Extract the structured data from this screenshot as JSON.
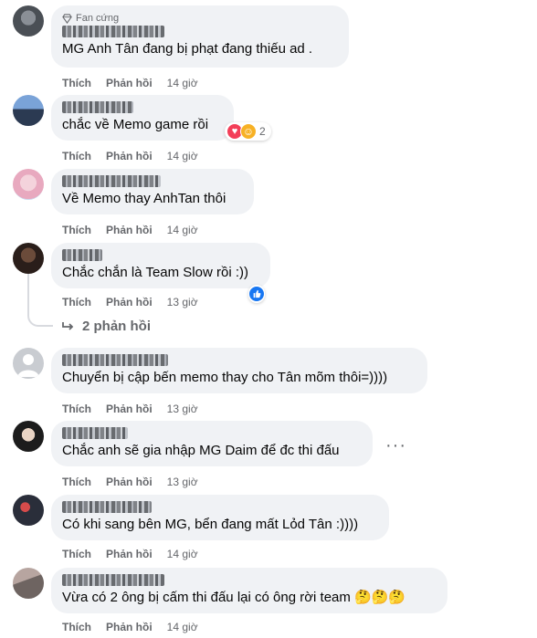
{
  "colors": {
    "bubble": "#f0f2f5",
    "secondary_text": "#65676b",
    "like_blue": "#1877f2",
    "heart_red": "#f33e58",
    "haha_yellow": "#f7b125"
  },
  "actions": {
    "like": "Thích",
    "reply": "Phản hồi"
  },
  "comments": [
    {
      "badge": "Fan cứng",
      "text": "MG Anh Tân đang bị phạt đang thiếu ad .",
      "time": "14 giờ"
    },
    {
      "text": "chắc về Memo game rồi",
      "time": "14 giờ",
      "reaction_count": "2",
      "reaction_icons": [
        "heart-icon",
        "care-icon"
      ]
    },
    {
      "text": "Về Memo thay AnhTan thôi",
      "time": "14 giờ"
    },
    {
      "text": "Chắc chắn là Team Slow rồi :))",
      "time": "13 giờ",
      "reaction_icons": [
        "like-icon"
      ]
    },
    {
      "text": "Chuyển bị cập bến memo thay cho Tân mõm thôi=))))",
      "time": "13 giờ"
    },
    {
      "text": "Chắc anh sẽ gia nhập MG Daim để đc thi đấu",
      "time": "13 giờ",
      "more_icon": "more-options-icon"
    },
    {
      "text": "Có khi sang bên MG, bển đang mất Lỏd Tân :))))",
      "time": "14 giờ"
    },
    {
      "text": "Vừa có 2 ông bị cấm thi đấu lại có ông rời team",
      "time": "14 giờ",
      "trailing_emoji": "🤔🤔🤔"
    }
  ],
  "replies_link": "2 phản hồi"
}
